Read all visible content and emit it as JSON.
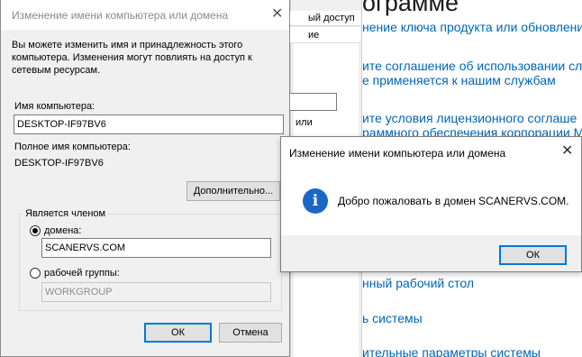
{
  "background": {
    "heading": "ограмме",
    "links": [
      "нение ключа продукта или обновление",
      "ите соглашение об использовании слу",
      "е применяется к нашим службам",
      "ите условия лицензионного соглаше",
      "раммного обеспечения корпорации Ма",
      "нный рабочий стол",
      "ь системы",
      "ительные параметры системы"
    ]
  },
  "middle": {
    "tab_label": "ый доступ",
    "tab2_label": "ие",
    "text": "или"
  },
  "dialog": {
    "title": "Изменение имени компьютера или домена",
    "close_glyph": "✕",
    "description": "Вы можете изменить имя и принадлежность этого компьютера. Изменения могут повлиять на доступ к сетевым ресурсам.",
    "computer_name_label": "Имя компьютера:",
    "computer_name_value": "DESKTOP-IF97BV6",
    "full_name_label": "Полное имя компьютера:",
    "full_name_value": "DESKTOP-IF97BV6",
    "more_button": "Дополнительно...",
    "member_group_label": "Является членом",
    "domain_label": "домена:",
    "domain_value": "SCANERVS.COM",
    "workgroup_label": "рабочей группы:",
    "workgroup_value": "WORKGROUP",
    "ok_button": "ОК",
    "cancel_button": "Отмена"
  },
  "message_box": {
    "title": "Изменение имени компьютера или домена",
    "close_glyph": "✕",
    "icon": "info-icon",
    "icon_glyph": "i",
    "text": "Добро пожаловать в домен SCANERVS.COM.",
    "ok_button": "ОК"
  },
  "colors": {
    "link": "#0066b4",
    "focus_border": "#0078d7",
    "info_icon": "#1c67c6"
  }
}
